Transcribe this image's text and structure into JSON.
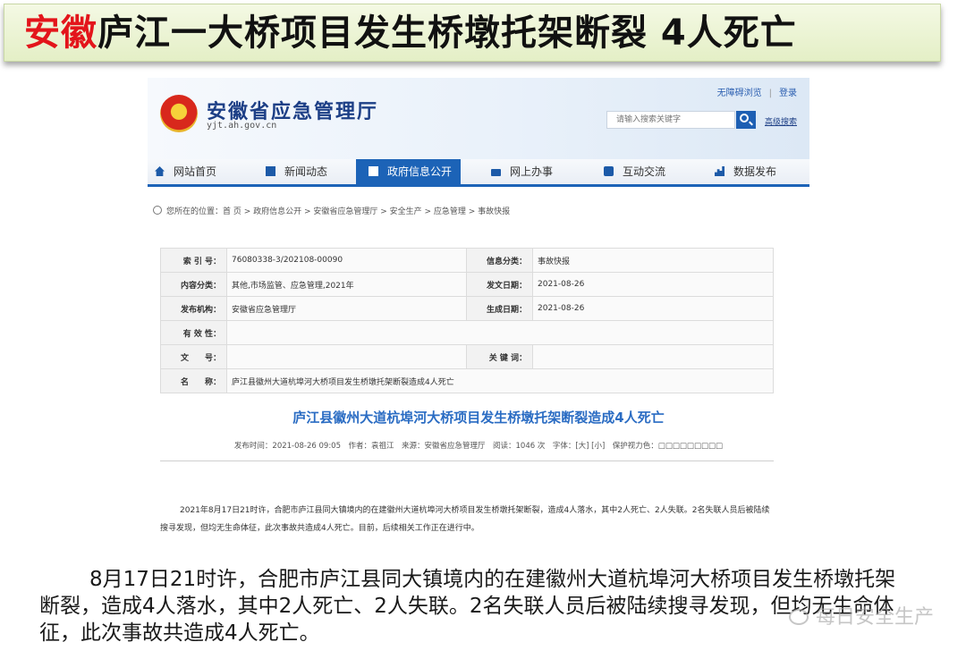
{
  "banner": {
    "title_red": "安徽",
    "title_rest": "庐江一大桥项目发生桥墩托架断裂 4人死亡"
  },
  "site": {
    "name": "安徽省应急管理厅",
    "domain": "yjt.ah.gov.cn",
    "top_links": [
      "无障碍浏览",
      "登录"
    ],
    "search_placeholder": "请输入搜索关键字",
    "advanced_search": "高级搜索"
  },
  "nav": [
    {
      "label": "网站首页",
      "icon": "home-icon"
    },
    {
      "label": "新闻动态",
      "icon": "news-icon"
    },
    {
      "label": "政府信息公开",
      "icon": "document-icon",
      "active": true
    },
    {
      "label": "网上办事",
      "icon": "monitor-icon"
    },
    {
      "label": "互动交流",
      "icon": "chat-icon"
    },
    {
      "label": "数据发布",
      "icon": "chart-icon"
    }
  ],
  "breadcrumb": "您所在的位置：首 页 > 政府信息公开 > 安徽省应急管理厅 > 安全生产 > 应急管理 > 事故快报",
  "info": {
    "index_label": "索 引 号：",
    "index_value": "76080338-3/202108-00090",
    "category_label": "信息分类：",
    "category_value": "事故快报",
    "content_label": "内容分类：",
    "content_value": "其他,市场监管、应急管理,2021年",
    "date_label": "发文日期：",
    "date_value": "2021-08-26",
    "org_label": "发布机构：",
    "org_value": "安徽省应急管理厅",
    "gen_label": "生成日期：",
    "gen_value": "2021-08-26",
    "valid_label": "有 效 性：",
    "doc_label": "文　　号：",
    "keyword_label": "关 键 词：",
    "name_label": "名　　称：",
    "name_value": "庐江县徽州大道杭埠河大桥项目发生桥墩托架断裂造成4人死亡"
  },
  "article": {
    "title": "庐江县徽州大道杭埠河大桥项目发生桥墩托架断裂造成4人死亡",
    "meta": "发布时间：2021-08-26 09:05　作者：袁祖江　来源：安徽省应急管理厅　阅读：1046 次　字体：[大] [小]　保护视力色：□□□□□□□□□",
    "body": "2021年8月17日21时许，合肥市庐江县同大镇境内的在建徽州大道杭埠河大桥项目发生桥墩托架断裂，造成4人落水，其中2人死亡、2人失联。2名失联人员后被陆续搜寻发现，但均无生命体征，此次事故共造成4人死亡。目前，后续相关工作正在进行中。"
  },
  "slide_text": "8月17日21时许，合肥市庐江县同大镇境内的在建徽州大道杭埠河大桥项目发生桥墩托架断裂，造成4人落水，其中2人死亡、2人失联。2名失联人员后被陆续搜寻发现，但均无生命体征，此次事故共造成4人死亡。",
  "watermark": "每日安全生产"
}
